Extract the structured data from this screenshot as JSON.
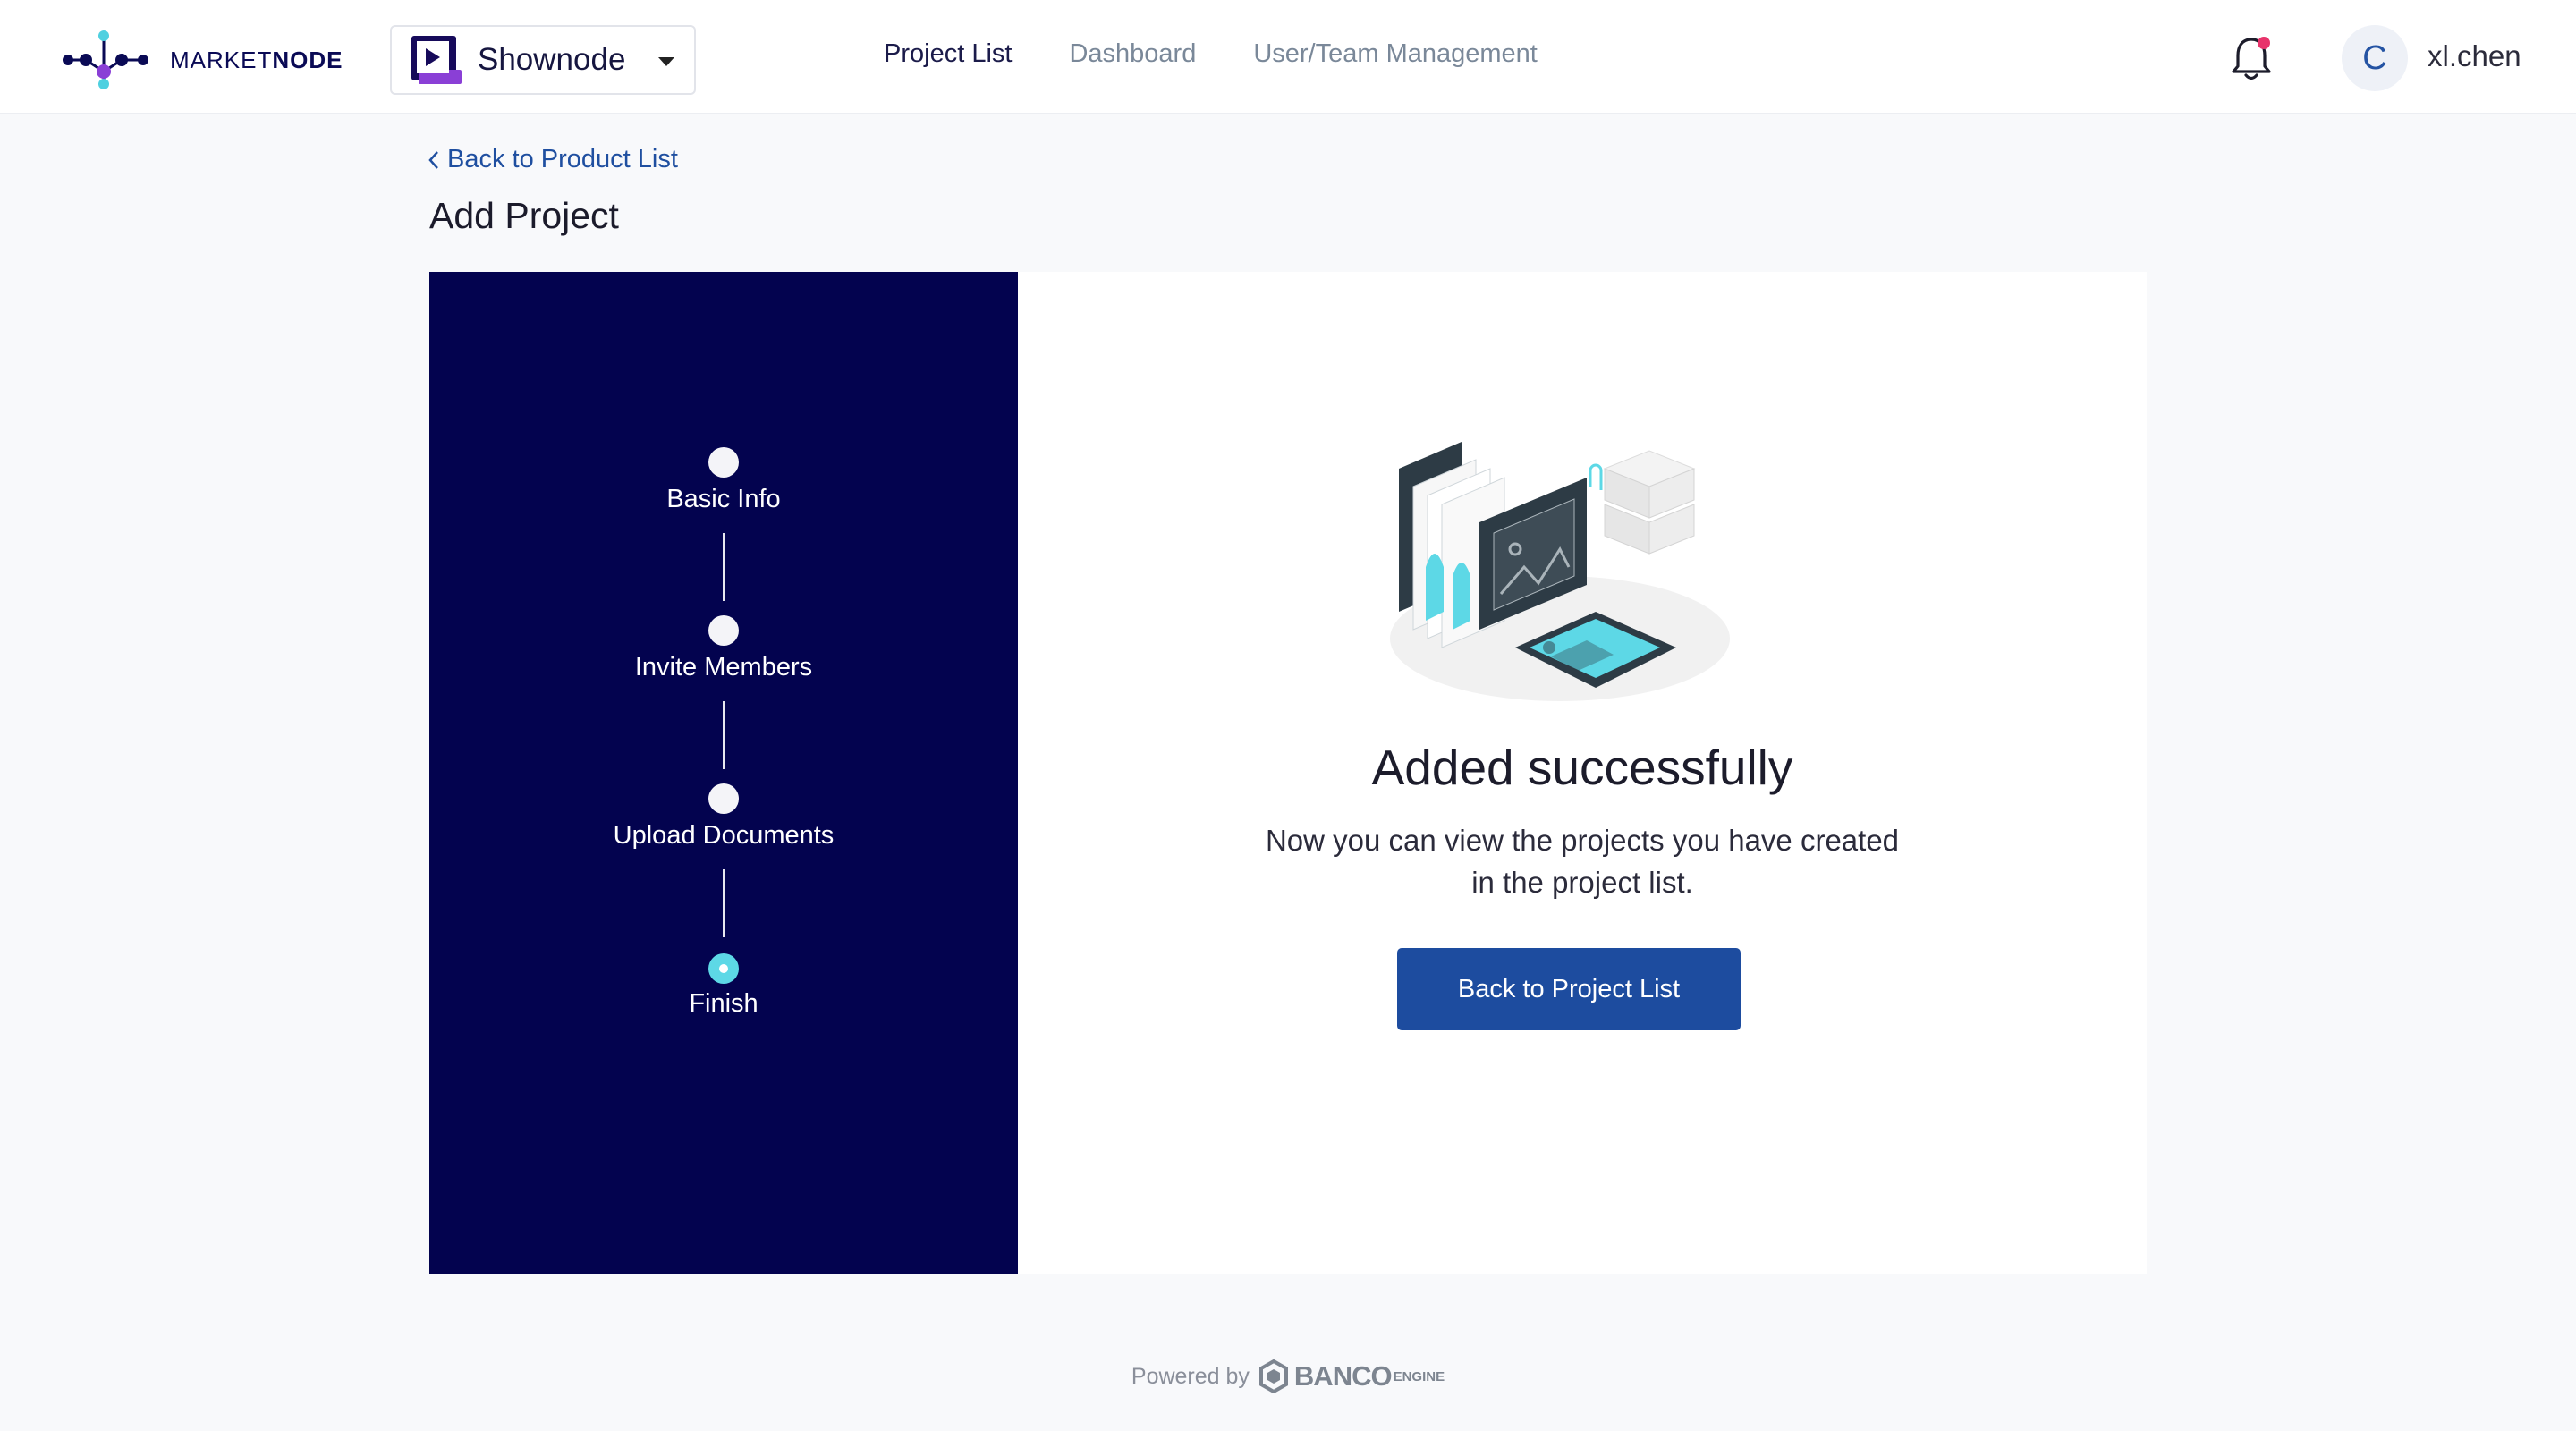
{
  "header": {
    "logo_text_light": "MARKET",
    "logo_text_bold": "NODE",
    "workspace": {
      "name": "Shownode"
    },
    "nav": [
      {
        "label": "Project List",
        "active": true
      },
      {
        "label": "Dashboard",
        "active": false
      },
      {
        "label": "User/Team Management",
        "active": false
      }
    ],
    "user": {
      "initial": "C",
      "name": "xl.chen"
    }
  },
  "page": {
    "back_link": "Back to Product List",
    "title": "Add Project"
  },
  "stepper": {
    "steps": [
      {
        "label": "Basic Info",
        "state": "done"
      },
      {
        "label": "Invite Members",
        "state": "done"
      },
      {
        "label": "Upload Documents",
        "state": "done"
      },
      {
        "label": "Finish",
        "state": "active"
      }
    ]
  },
  "result": {
    "title": "Added successfully",
    "message_line1": "Now you can view the projects you have created",
    "message_line2": "in the project list.",
    "button": "Back to Project List"
  },
  "footer": {
    "powered_by": "Powered by",
    "brand": "BANCO",
    "brand_suffix": "ENGINE"
  },
  "colors": {
    "panel": "#03034f",
    "accent": "#1d4c9f",
    "step_active": "#5dd8e6",
    "notification_dot": "#e8336b"
  }
}
